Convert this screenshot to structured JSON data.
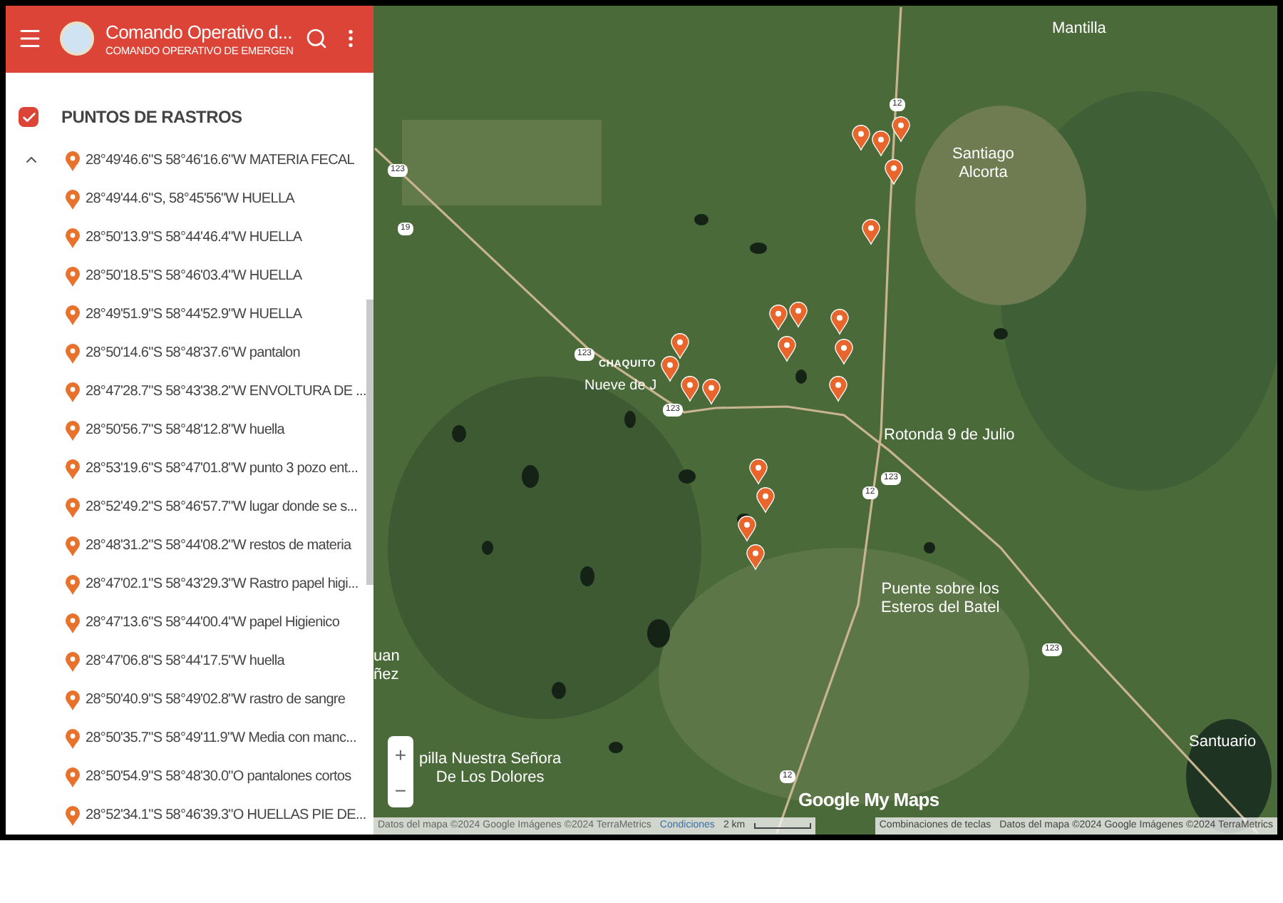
{
  "header": {
    "title": "Comando Operativo d...",
    "subtitle": "COMANDO OPERATIVO DE EMERGEN"
  },
  "layer": {
    "title": "PUNTOS DE RASTROS",
    "checked": true,
    "expanded": true,
    "items": [
      "28°49'46.6\"S 58°46'16.6\"W MATERIA FECAL",
      "28°49'44.6\"S, 58°45'56\"W HUELLA",
      "28°50'13.9\"S 58°44'46.4\"W HUELLA",
      "28°50'18.5\"S 58°46'03.4\"W HUELLA",
      "28°49'51.9\"S 58°44'52.9\"W HUELLA",
      "28°50'14.6\"S 58°48'37.6\"W pantalon",
      "28°47'28.7\"S 58°43'38.2\"W ENVOLTURA DE ...",
      "28°50'56.7\"S 58°48'12.8\"W huella",
      "28°53'19.6\"S 58°47'01.8\"W punto 3 pozo ent...",
      "28°52'49.2\"S 58°46'57.7\"W lugar donde se s...",
      "28°48'31.2\"S 58°44'08.2\"W restos de materia",
      "28°47'02.1\"S 58°43'29.3\"W Rastro papel higi...",
      "28°47'13.6\"S 58°44'00.4\"W papel Higienico",
      "28°47'06.8\"S 58°44'17.5\"W huella",
      "28°50'40.9\"S 58°49'02.8\"W rastro de sangre",
      "28°50'35.7\"S 58°49'11.9\"W Media con manc...",
      "28°50'54.9\"S 58°48'30.0\"O pantalones cortos",
      "28°52'34.1\"S 58°46'39.3\"O HUELLAS PIE DE..."
    ]
  },
  "map": {
    "places": [
      [
        "Mantilla"
      ],
      [
        "Santiago",
        "Alcorta"
      ],
      [
        "CHAQUITO"
      ],
      [
        "Nueve de J"
      ],
      [
        "Rotonda 9 de Julio"
      ],
      [
        "Puente sobre los",
        "Esteros del Batel"
      ],
      [
        "Santuario"
      ],
      [
        "pilla Nuestra Señora",
        "De Los Dolores"
      ],
      [
        "uan",
        "ñez"
      ]
    ],
    "road_signs": [
      "123",
      "19",
      "12",
      "123",
      "123",
      "12",
      "123",
      "123",
      "12"
    ],
    "zoom_in": "+",
    "zoom_out": "−",
    "logo": "Google My Maps",
    "attribution": "Datos del mapa ©2024 Google Imágenes ©2024 TerraMetrics",
    "terms": "Condiciones",
    "scale": "2 km",
    "shortcuts": "Combinaciones de teclas",
    "attribution_right": "Datos del mapa ©2024 Google Imágenes ©2024 TerraMetrics"
  }
}
